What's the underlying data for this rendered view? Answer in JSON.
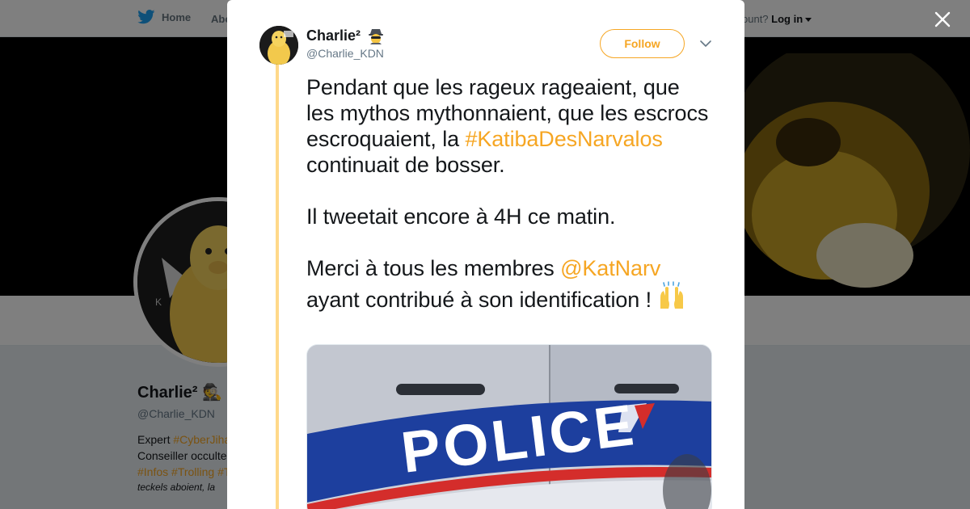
{
  "nav": {
    "home_label": "Home",
    "about_label": "Abo",
    "account_prompt": "ccount?",
    "login_label": "Log in"
  },
  "profile": {
    "name": "Charlie²",
    "handle": "@Charlie_KDN",
    "bio_line1_prefix": "Expert ",
    "bio_line1_tag": "#CyberJiha",
    "bio_line2": "Conseiller occulte",
    "bio_line3_tags": "#Infos #Trolling #T",
    "bio_line4": "teckels aboient, la",
    "avatar_badge": "K"
  },
  "tweet": {
    "author_name": "Charlie²",
    "author_emoji": "spy-emoji",
    "author_handle": "@Charlie_KDN",
    "follow_label": "Follow",
    "para1_text": "Pendant que les rageux rageaient, que les mythos mythonnaient, que les escrocs escroquaient, la ",
    "para1_hashtag": "#KatibaDesNarvalos",
    "para1_end": " continuait de bosser.",
    "para2": "Il tweetait encore à 4H ce matin.",
    "para3_text": "Merci à tous les membres ",
    "para3_mention": "@KatNarv",
    "para3_end": " ayant contribué à son identification ! ",
    "para3_emoji": "raising-hands-emoji",
    "image_text": "POLICE"
  },
  "colors": {
    "accent": "#f6a623",
    "thread_line": "#ffd98a",
    "overlay": "rgba(0,0,0,0.5)",
    "text": "#14171a",
    "muted": "#657786",
    "police_blue": "#1d3f9e",
    "police_red": "#d42d2b"
  },
  "icons": {
    "close": "close-icon",
    "more": "chevron-down-icon",
    "brand": "twitter-bird-icon"
  }
}
